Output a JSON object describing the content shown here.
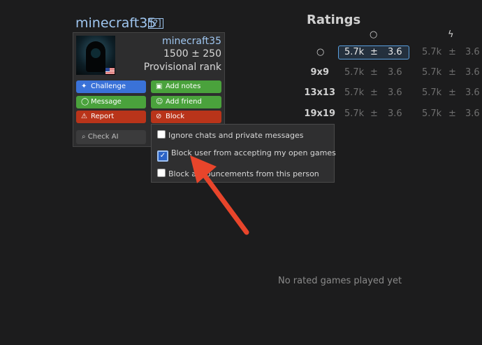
{
  "profile": {
    "username": "minecraft35",
    "help": "[?]"
  },
  "card": {
    "name": "minecraft35",
    "rating": "1500 ± 250",
    "rank": "Provisional rank",
    "buttons": {
      "challenge": "Challenge",
      "add_notes": "Add notes",
      "message": "Message",
      "add_friend": "Add friend",
      "report": "Report",
      "block": "Block"
    },
    "check_ai": "Check AI"
  },
  "block_menu": {
    "items": [
      {
        "label": "Ignore chats and private messages",
        "checked": false
      },
      {
        "label": "Block user from accepting my open games",
        "checked": true
      },
      {
        "label": "Block announcements from this person",
        "checked": false
      }
    ]
  },
  "ratings": {
    "title": "Ratings",
    "rows": [
      {
        "label": "",
        "v1": "5.7k",
        "pm1": "±",
        "d1": "3.6",
        "v2": "5.7k",
        "pm2": "±",
        "d2": "3.6"
      },
      {
        "label": "9x9",
        "v1": "5.7k",
        "pm1": "±",
        "d1": "3.6",
        "v2": "5.7k",
        "pm2": "±",
        "d2": "3.6"
      },
      {
        "label": "13x13",
        "v1": "5.7k",
        "pm1": "±",
        "d1": "3.6",
        "v2": "5.7k",
        "pm2": "±",
        "d2": "3.6"
      },
      {
        "label": "19x19",
        "v1": "5.7k",
        "pm1": "±",
        "d1": "3.6",
        "v2": "5.7k",
        "pm2": "±",
        "d2": "3.6"
      }
    ],
    "empty_message": "No rated games played yet"
  },
  "colors": {
    "accent": "#3a72d8",
    "positive": "#4aa23c",
    "danger": "#b9341a",
    "annotation": "#e8452b"
  }
}
